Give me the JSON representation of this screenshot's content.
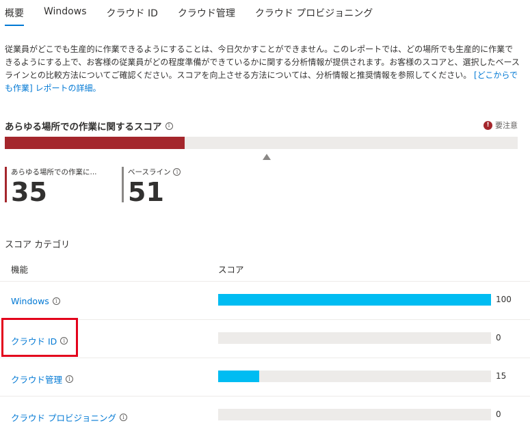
{
  "tabs": [
    {
      "label": "概要",
      "active": true
    },
    {
      "label": "Windows",
      "active": false
    },
    {
      "label": "クラウド ID",
      "active": false
    },
    {
      "label": "クラウド管理",
      "active": false
    },
    {
      "label": "クラウド プロビジョニング",
      "active": false
    }
  ],
  "description": {
    "text": "従業員がどこでも生産的に作業できるようにすることは、今日欠かすことができません。このレポートでは、どの場所でも生産的に作業できるようにする上で、お客様の従業員がどの程度準備ができているかに関する分析情報が提供されます。お客様のスコアと、選択したベースラインとの比較方法についてご確認ください。スコアを向上させる方法については、分析情報と推奨情報を参照してください。",
    "link": "[どこからでも作業] レポートの詳細。"
  },
  "score_section": {
    "title": "あらゆる場所での作業に関するスコア",
    "status_label": "要注意",
    "status_color": "#a4262c",
    "score": 35,
    "baseline": 51,
    "max": 100
  },
  "kpis": [
    {
      "label": "あらゆる場所での作業に...",
      "value": "35"
    },
    {
      "label": "ベースライン",
      "value": "51"
    }
  ],
  "category": {
    "title": "スコア カテゴリ",
    "col_feature": "機能",
    "col_score": "スコア",
    "rows": [
      {
        "name": "Windows",
        "score": 100,
        "score_label": "100"
      },
      {
        "name": "クラウド ID",
        "score": 0,
        "score_label": "0"
      },
      {
        "name": "クラウド管理",
        "score": 15,
        "score_label": "15"
      },
      {
        "name": "クラウド プロビジョニング",
        "score": 0,
        "score_label": "0"
      }
    ]
  },
  "colors": {
    "accent": "#0078d4",
    "bar": "#00bcf2",
    "alert": "#a4262c",
    "highlight": "#e3001b"
  },
  "icons": {
    "info": "info-icon",
    "attention": "attention-icon"
  }
}
